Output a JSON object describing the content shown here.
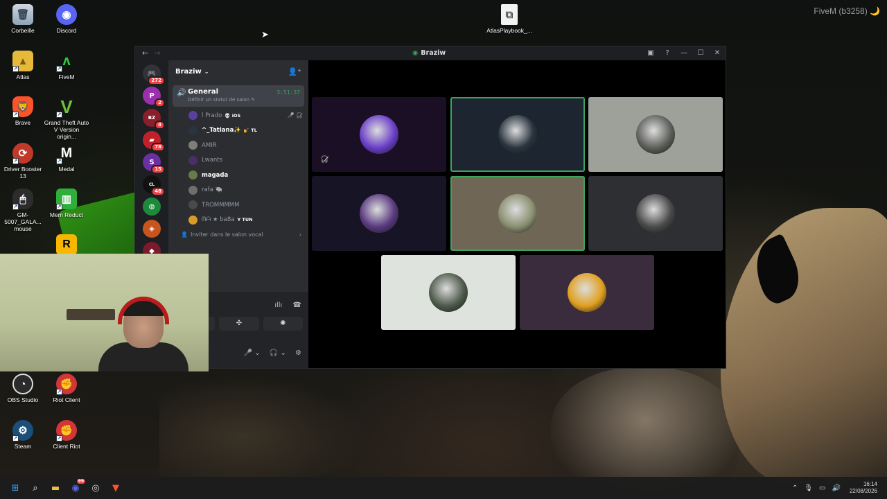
{
  "desktop": {
    "corner_label": "FiveM (b3258) 🌙",
    "icons": [
      {
        "label": "Corbeille",
        "icon": "recycle-bin-icon"
      },
      {
        "label": "Discord",
        "icon": "discord-icon"
      },
      {
        "label": "Atlas",
        "icon": "folder-icon"
      },
      {
        "label": "FiveM",
        "icon": "fivem-icon"
      },
      {
        "label": "Brave",
        "icon": "brave-icon"
      },
      {
        "label": "Grand Theft Auto V Version origin...",
        "icon": "gta-icon"
      },
      {
        "label": "Driver Booster 13",
        "icon": "driver-booster-icon"
      },
      {
        "label": "Medal",
        "icon": "medal-icon"
      },
      {
        "label": "GM-5007_GALA... mouse",
        "icon": "mouse-icon"
      },
      {
        "label": "Mem Reduct",
        "icon": "mem-reduct-icon"
      },
      {
        "label": "OBS Studio",
        "icon": "obs-icon"
      },
      {
        "label": "Riot Client",
        "icon": "riot-client-icon"
      },
      {
        "label": "Steam",
        "icon": "steam-icon"
      },
      {
        "label": "Client Riot",
        "icon": "riot-icon"
      },
      {
        "label": "AtlasPlaybook_...",
        "icon": "file-icon"
      }
    ]
  },
  "discord": {
    "window_title": "Braziw",
    "guild_name": "Braziw",
    "servers": [
      {
        "badge": "272"
      },
      {
        "badge": "2"
      },
      {
        "badge": "4"
      },
      {
        "badge": "78"
      },
      {
        "badge": "15"
      },
      {
        "badge": "48"
      },
      {
        "badge": ""
      },
      {
        "badge": ""
      },
      {
        "badge": ""
      }
    ],
    "voice_channel": {
      "name": "General",
      "status": "Définir un statut de salon ✎",
      "timer": "3:51:37"
    },
    "members": [
      {
        "name": "l Prado",
        "tag": "💀 iOS",
        "active": false,
        "color": "#5b3fa0",
        "mic": "🎤̸ 🎧̸"
      },
      {
        "name": "^_Tatiana✨",
        "tag": "💅 TL",
        "active": true,
        "color": "#2a3440",
        "mic": ""
      },
      {
        "name": "AMIR",
        "tag": "",
        "active": false,
        "color": "#7d7f78",
        "mic": ""
      },
      {
        "name": "Lwants",
        "tag": "",
        "active": false,
        "color": "#4a2e6a",
        "mic": ""
      },
      {
        "name": "magada",
        "tag": "",
        "active": true,
        "color": "#6b7a4a",
        "mic": ""
      },
      {
        "name": "rafa 🐃",
        "tag": "",
        "active": false,
        "color": "#6e6e6e",
        "mic": ""
      },
      {
        "name": "TROMMMMM",
        "tag": "",
        "active": false,
        "color": "#4a4a4a",
        "mic": ""
      },
      {
        "name": "ᗰᗩ ★ ba8a",
        "tag": "Y TUN",
        "active": false,
        "color": "#d89b2a",
        "mic": ""
      }
    ],
    "invite_label": "Inviter dans le salon vocal",
    "tiles": [
      {
        "bg": "#1a0f24",
        "avatar": "#6a3fc8",
        "speaking": false,
        "muted": true
      },
      {
        "bg": "#1d2630",
        "avatar": "#2b3540",
        "speaking": true,
        "muted": false
      },
      {
        "bg": "#9ea09a",
        "avatar": "#5d5f5a",
        "speaking": false,
        "muted": false
      },
      {
        "bg": "#171426",
        "avatar": "#5a3a80",
        "speaking": false,
        "muted": false
      },
      {
        "bg": "#6f6656",
        "avatar": "#8a8f70",
        "speaking": true,
        "muted": false
      },
      {
        "bg": "#2e2f32",
        "avatar": "#4a4a4a",
        "speaking": false,
        "muted": false
      },
      {
        "bg": "#dfe3dd",
        "avatar": "#4f5a4c",
        "speaking": false,
        "muted": false
      },
      {
        "bg": "#3b2c3d",
        "avatar": "#e0a020",
        "speaking": false,
        "muted": false
      }
    ]
  },
  "taskbar": {
    "time": "16:14",
    "date": "22/08/2026",
    "discord_badge": "99"
  }
}
